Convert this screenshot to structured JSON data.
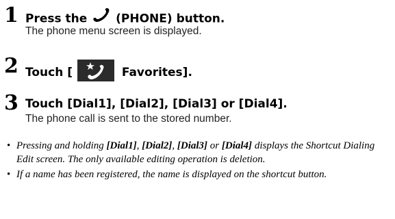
{
  "steps": [
    {
      "number": "1",
      "title_before": "Press the",
      "title_after": "(PHONE) button.",
      "description": "The phone menu screen is displayed.",
      "icon": "phone-handset-icon"
    },
    {
      "number": "2",
      "title_before": "Touch [",
      "title_after": "Favorites].",
      "icon": "favorites-phone-star-icon"
    },
    {
      "number": "3",
      "title": "Touch [Dial1], [Dial2], [Dial3] or [Dial4].",
      "description": "The phone call is sent to the stored number."
    }
  ],
  "notes": [
    {
      "bullet": "•",
      "parts": {
        "b1": "[Dial1]",
        "t1": ", ",
        "b2": "[Dial2]",
        "t2": ", ",
        "b3": "[Dial3]",
        "t3": " or ",
        "b4": "[Dial4]",
        "prefix": "Pressing and holding ",
        "suffix": " displays the Shortcut Dialing Edit screen. The only available editing operation is deletion."
      }
    },
    {
      "bullet": "•",
      "text": "If a name has been registered, the name is displayed on the shortcut button."
    }
  ],
  "colors": {
    "text": "#000000",
    "icon_box": "#2b2b2b",
    "icon_fg": "#ffffff"
  }
}
